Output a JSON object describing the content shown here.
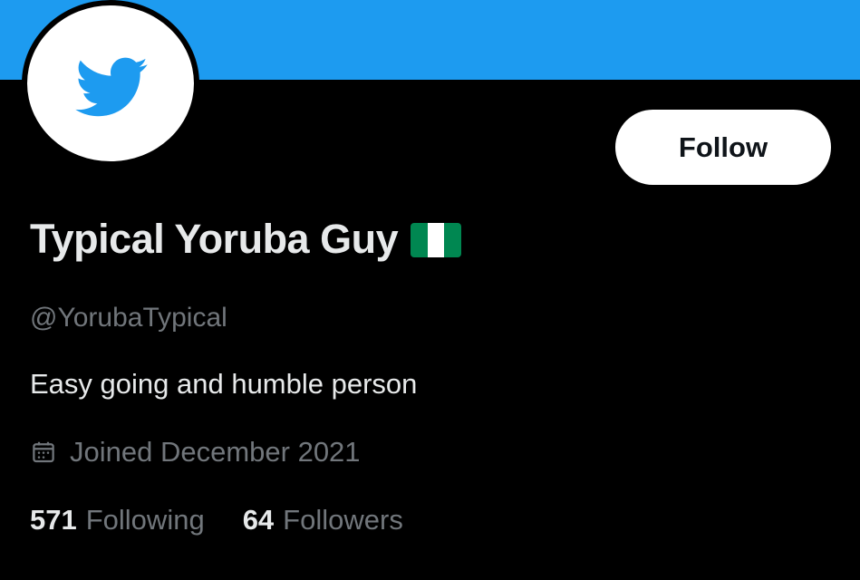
{
  "colors": {
    "banner": "#1d9bf0",
    "background": "#000000",
    "primary_text": "#e7e9ea",
    "secondary_text": "#71767b",
    "twitter_blue": "#1d9bf0",
    "flag_green": "#008751",
    "flag_white": "#ffffff"
  },
  "avatar": {
    "icon": "twitter-bird-icon"
  },
  "actions": {
    "follow_label": "Follow"
  },
  "profile": {
    "display_name": "Typical Yoruba Guy",
    "flag_icon": "nigeria-flag-icon",
    "handle": "@YorubaTypical",
    "bio": "Easy going and humble person",
    "joined_icon": "calendar-icon",
    "joined": "Joined December 2021"
  },
  "stats": {
    "following_count": "571",
    "following_label": "Following",
    "followers_count": "64",
    "followers_label": "Followers"
  }
}
